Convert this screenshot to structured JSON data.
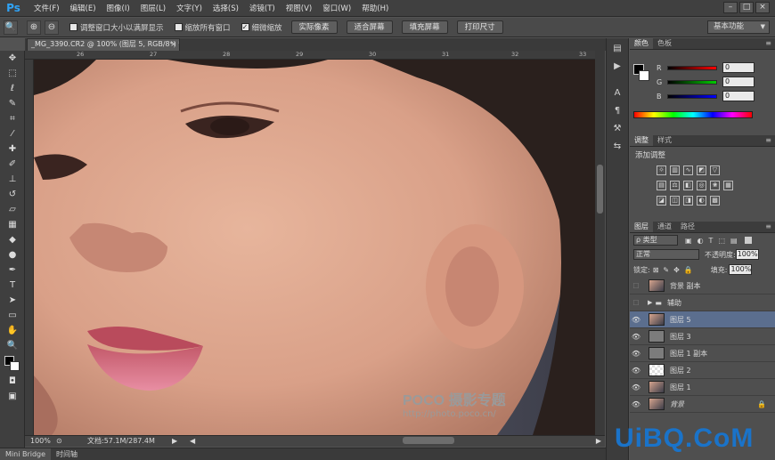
{
  "app": {
    "logo": "Ps"
  },
  "menu": [
    "文件(F)",
    "编辑(E)",
    "图像(I)",
    "图层(L)",
    "文字(Y)",
    "选择(S)",
    "滤镜(T)",
    "视图(V)",
    "窗口(W)",
    "帮助(H)"
  ],
  "window_controls": [
    "–",
    "□",
    "×"
  ],
  "options": {
    "tool_icon": "zoom-icon",
    "checkboxes": [
      {
        "label": "调整窗口大小以满屏显示",
        "checked": false
      },
      {
        "label": "缩放所有窗口",
        "checked": false
      },
      {
        "label": "细微缩放",
        "checked": true
      }
    ],
    "buttons": [
      "实际像素",
      "适合屏幕",
      "填充屏幕",
      "打印尺寸"
    ],
    "workspace": "基本功能"
  },
  "document": {
    "tab_title": "_MG_3390.CR2 @ 100% (图层 5, RGB/8*) *",
    "close": "×"
  },
  "ruler": {
    "ticks": [
      "26",
      "27",
      "28",
      "29",
      "30",
      "31",
      "32",
      "33"
    ]
  },
  "status": {
    "zoom": "100%",
    "doc_info": "文档:57.1M/287.4M"
  },
  "bottom_tabs": [
    "Mini Bridge",
    "时间轴"
  ],
  "color_panel": {
    "tabs": [
      "颜色",
      "色板"
    ],
    "channels": [
      {
        "label": "R",
        "value": "0"
      },
      {
        "label": "G",
        "value": "0"
      },
      {
        "label": "B",
        "value": "0"
      }
    ]
  },
  "adjust_panel": {
    "tabs": [
      "调整",
      "样式"
    ],
    "title": "添加调整"
  },
  "layers_panel": {
    "tabs": [
      "图层",
      "通道",
      "路径"
    ],
    "filter": "ρ 类型",
    "blend": "正常",
    "opacity_label": "不透明度:",
    "opacity": "100%",
    "lock_label": "锁定:",
    "fill_label": "填充:",
    "fill": "100%",
    "layers": [
      {
        "name": "背景 副本",
        "visible": false,
        "thumb": "photo"
      },
      {
        "name": "辅助",
        "visible": false,
        "thumb": "folder"
      },
      {
        "name": "图层 5",
        "visible": true,
        "thumb": "photo",
        "selected": true
      },
      {
        "name": "图层 3",
        "visible": true,
        "thumb": "gray"
      },
      {
        "name": "图层 1 副本",
        "visible": true,
        "thumb": "gray"
      },
      {
        "name": "图层 2",
        "visible": true,
        "thumb": "transparent"
      },
      {
        "name": "图层 1",
        "visible": true,
        "thumb": "photo"
      },
      {
        "name": "背景",
        "visible": true,
        "thumb": "photo",
        "locked": true
      }
    ]
  },
  "watermark": {
    "brand": "POCO 摄影专题",
    "url": "http://photo.poco.cn/"
  },
  "site_mark": "UiBQ.CoM"
}
